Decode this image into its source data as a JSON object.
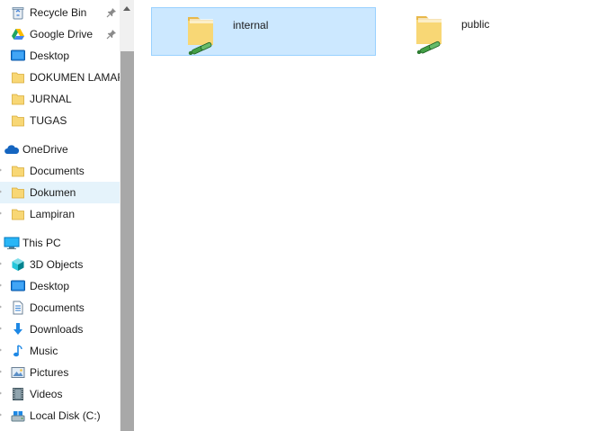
{
  "nav": {
    "quick_access": [
      {
        "label": "Recycle Bin",
        "icon": "recycle-bin-icon",
        "pinned": true
      },
      {
        "label": "Google Drive",
        "icon": "google-drive-icon",
        "pinned": true
      },
      {
        "label": "Desktop",
        "icon": "desktop-icon",
        "pinned": false
      },
      {
        "label": "DOKUMEN LAMARAN",
        "icon": "folder-icon",
        "pinned": false
      },
      {
        "label": "JURNAL",
        "icon": "folder-icon",
        "pinned": false
      },
      {
        "label": "TUGAS",
        "icon": "folder-icon",
        "pinned": false
      }
    ],
    "onedrive": {
      "label": "OneDrive",
      "icon": "onedrive-cloud-icon",
      "children": [
        {
          "label": "Documents",
          "icon": "folder-icon"
        },
        {
          "label": "Dokumen",
          "icon": "folder-icon",
          "selected": true
        },
        {
          "label": "Lampiran",
          "icon": "folder-icon"
        }
      ]
    },
    "this_pc": {
      "label": "This PC",
      "icon": "computer-icon",
      "children": [
        {
          "label": "3D Objects",
          "icon": "3d-objects-icon"
        },
        {
          "label": "Desktop",
          "icon": "desktop-icon"
        },
        {
          "label": "Documents",
          "icon": "documents-icon"
        },
        {
          "label": "Downloads",
          "icon": "downloads-icon"
        },
        {
          "label": "Music",
          "icon": "music-icon"
        },
        {
          "label": "Pictures",
          "icon": "pictures-icon"
        },
        {
          "label": "Videos",
          "icon": "videos-icon"
        },
        {
          "label": "Local Disk (C:)",
          "icon": "drive-icon"
        }
      ]
    }
  },
  "content": {
    "items": [
      {
        "name": "internal",
        "icon": "shared-folder-icon",
        "selected": true
      },
      {
        "name": "public",
        "icon": "shared-folder-icon",
        "selected": false
      }
    ]
  },
  "colors": {
    "nav_selected": "#e5f3fb",
    "tile_selected": "#cce8ff",
    "tile_selected_border": "#99d1ff",
    "folder_yellow": "#f8d775",
    "share_green": "#4caf50",
    "scroll_thumb": "#a8a8a8"
  }
}
